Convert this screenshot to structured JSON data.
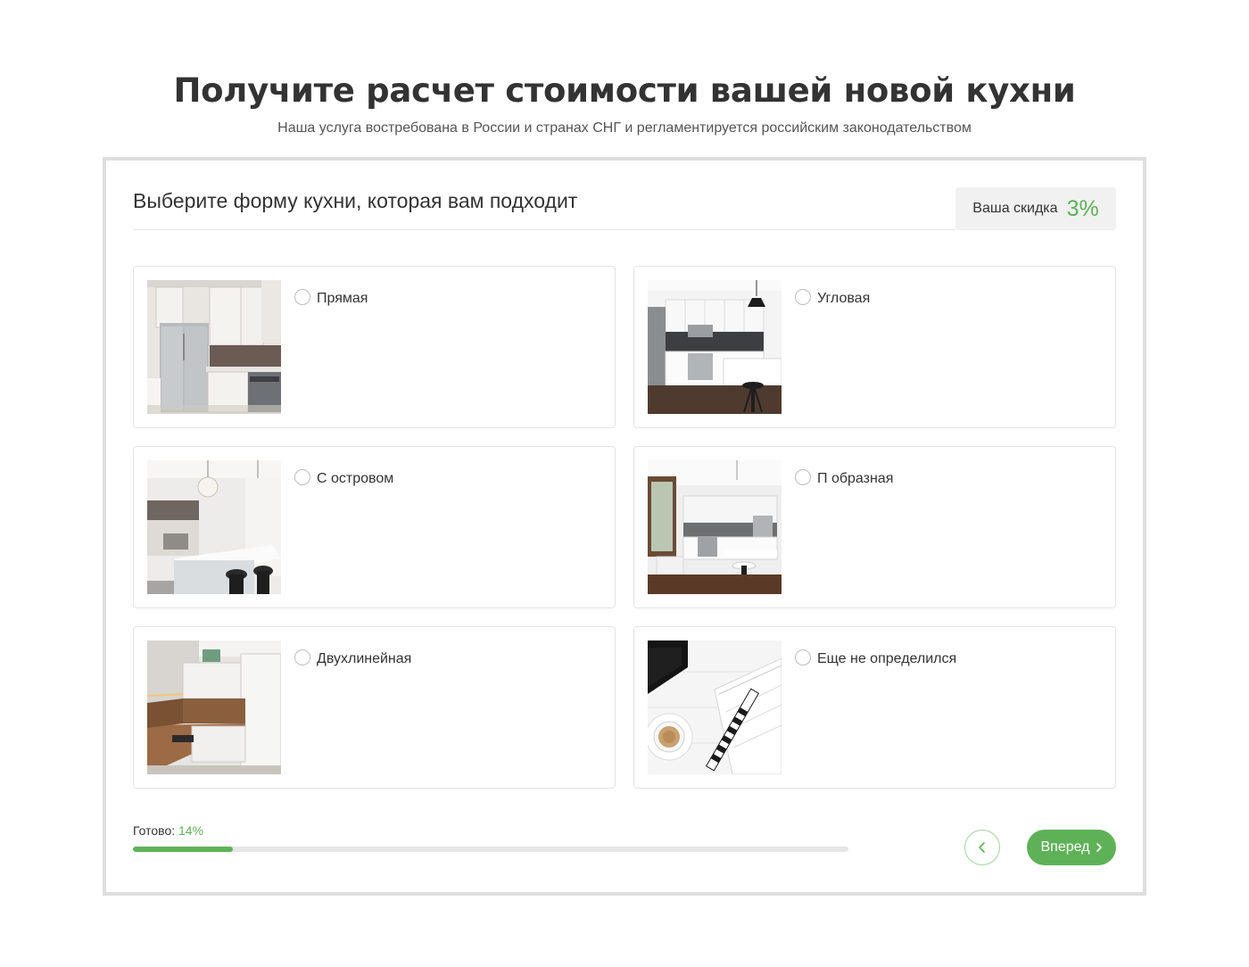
{
  "header": {
    "title": "Получите расчет стоимости вашей новой кухни",
    "subtitle": "Наша услуга востребована в России и странах СНГ и регламентируется российским законодательством"
  },
  "quiz": {
    "question": "Выберите форму кухни, которая вам подходит",
    "discount": {
      "label": "Ваша скидка",
      "value": "3%"
    },
    "options": [
      {
        "label": "Прямая",
        "image": "straight-kitchen-photo"
      },
      {
        "label": "Угловая",
        "image": "corner-kitchen-photo"
      },
      {
        "label": "С островом",
        "image": "island-kitchen-photo"
      },
      {
        "label": "П образная",
        "image": "u-shaped-kitchen-photo"
      },
      {
        "label": "Двухлинейная",
        "image": "two-line-kitchen-photo"
      },
      {
        "label": "Еще не определился",
        "image": "notebook-coffee-photo"
      }
    ],
    "progress": {
      "label": "Готово:",
      "percent_text": "14%",
      "fraction": 0.14
    },
    "nav": {
      "back_icon": "chevron-left-icon",
      "next_label": "Вперед",
      "next_icon": "chevron-right-icon"
    }
  },
  "colors": {
    "accent": "#5fb157",
    "frame": "#dedede",
    "text": "#333333"
  }
}
